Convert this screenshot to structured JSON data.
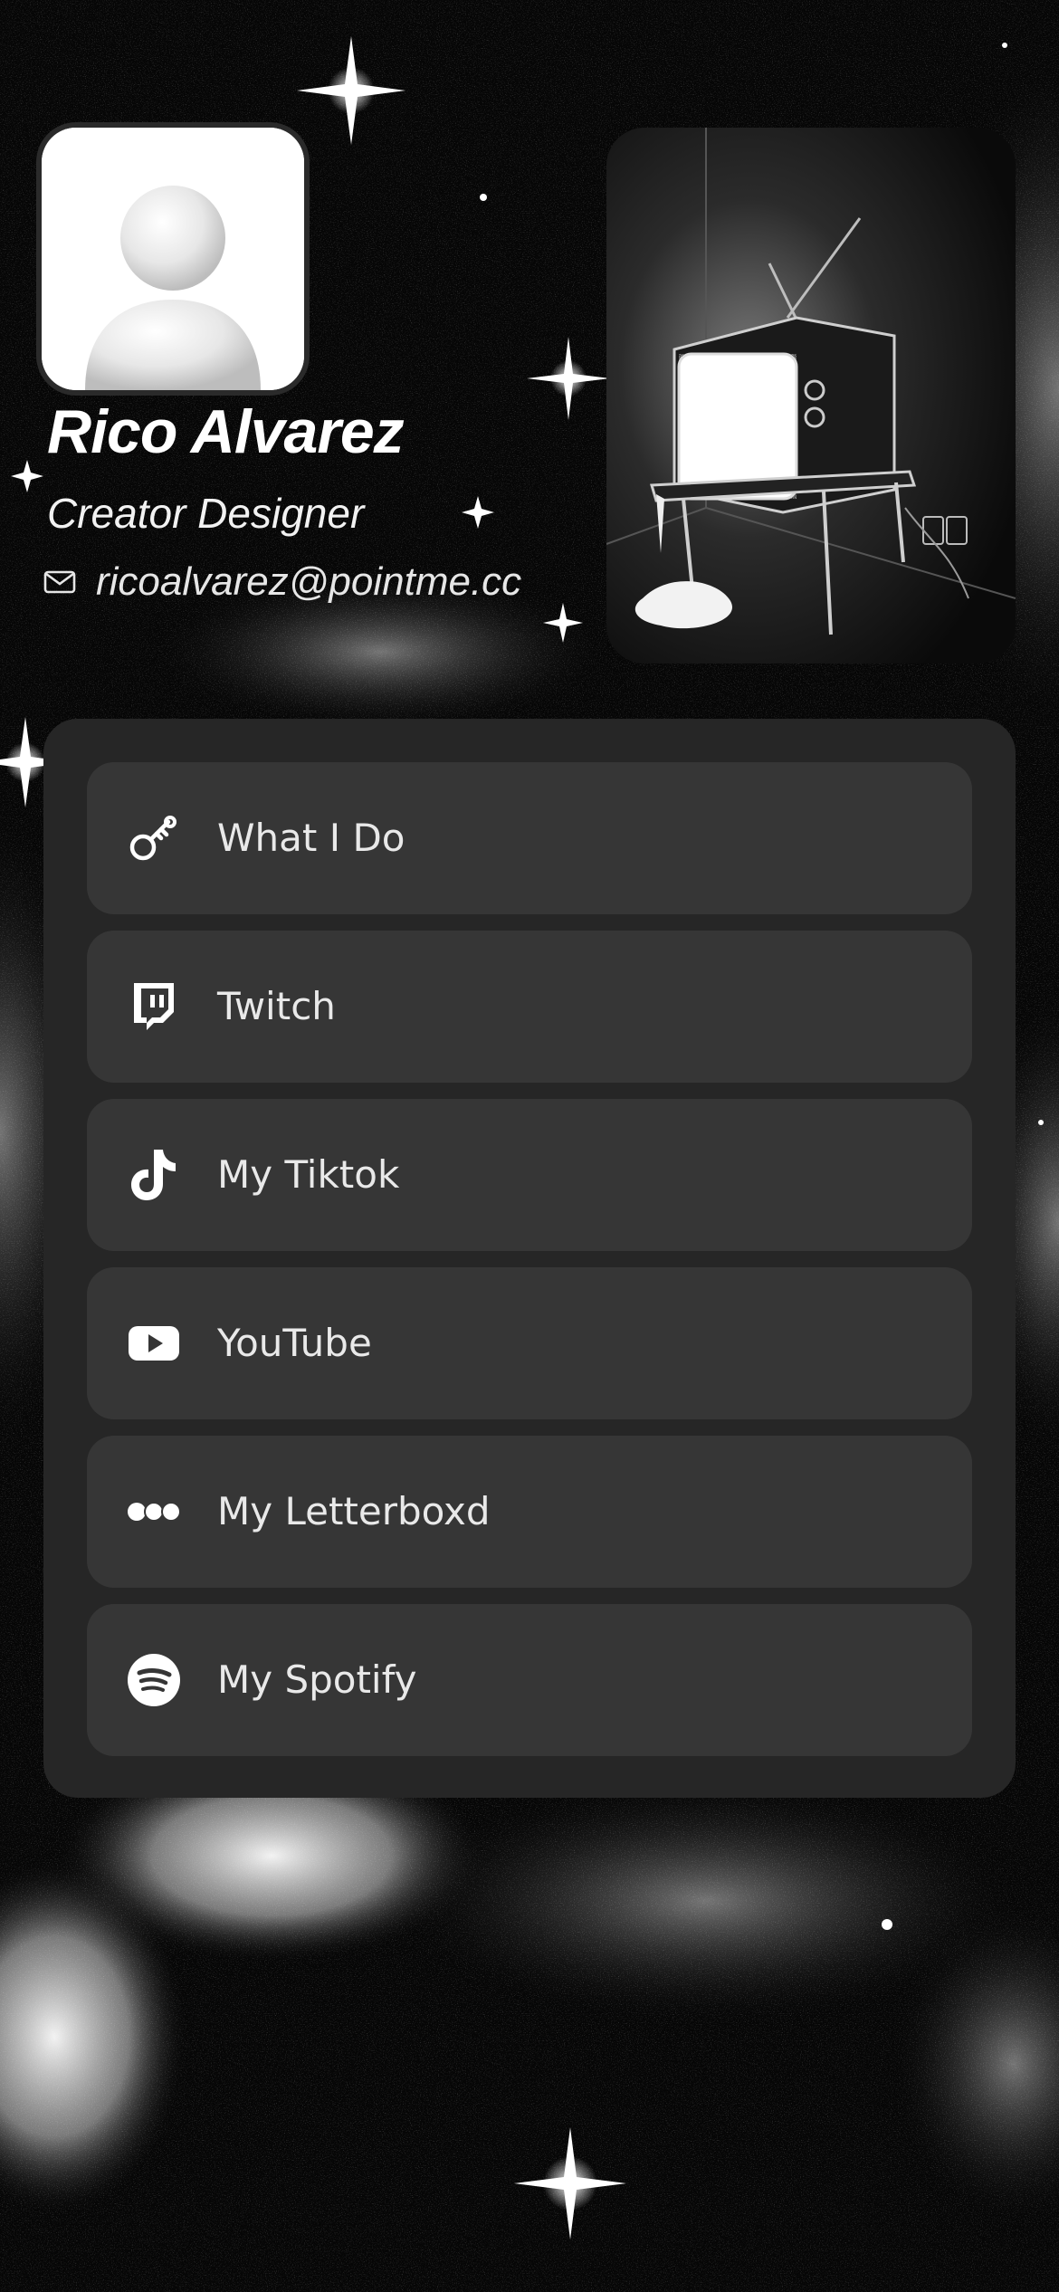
{
  "profile": {
    "name": "Rico Alvarez",
    "role": "Creator Designer",
    "email": "ricoalvarez@pointme.cc"
  },
  "links": [
    {
      "label": "What I Do",
      "icon": "key-icon"
    },
    {
      "label": "Twitch",
      "icon": "twitch-icon"
    },
    {
      "label": "My Tiktok",
      "icon": "tiktok-icon"
    },
    {
      "label": "YouTube",
      "icon": "youtube-icon"
    },
    {
      "label": "My Letterboxd",
      "icon": "letterboxd-icon"
    },
    {
      "label": "My Spotify",
      "icon": "spotify-icon"
    }
  ],
  "colors": {
    "background": "#050505",
    "panel": "#262626",
    "link_button": "#363636",
    "text": "#ffffff"
  }
}
